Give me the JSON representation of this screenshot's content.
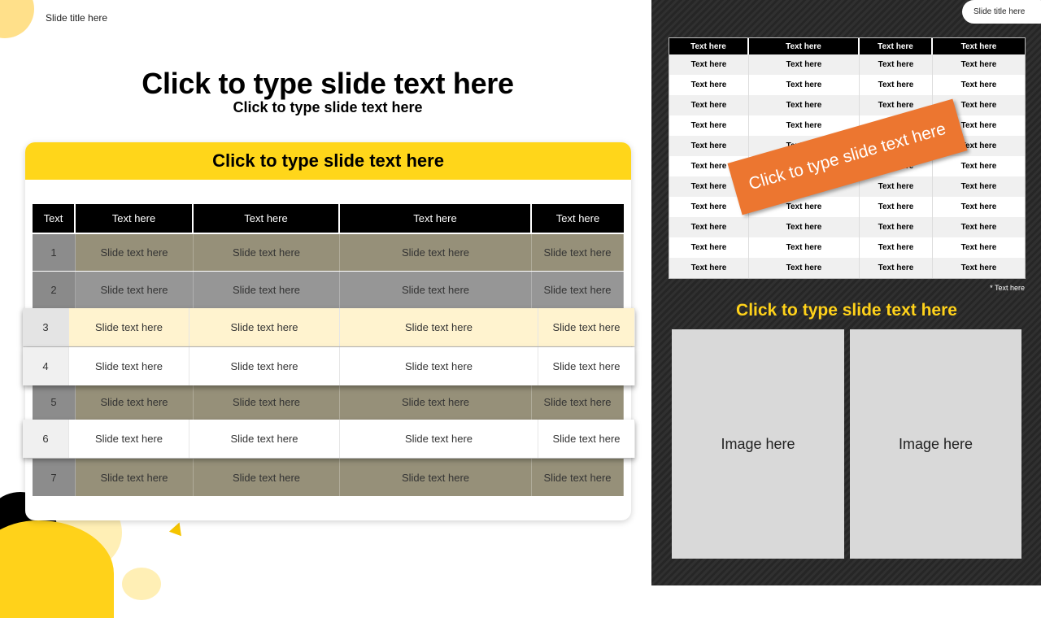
{
  "slide_title": "Slide title here",
  "main_title": "Click to type slide text here",
  "main_subtitle": "Click to type slide text here",
  "card_title": "Click to type slide text here",
  "table": {
    "headers": [
      "Text",
      "Text here",
      "Text here",
      "Text here",
      "Text here"
    ],
    "rows": [
      [
        "1",
        "Slide text here",
        "Slide text here",
        "Slide text here",
        "Slide text here"
      ],
      [
        "2",
        "Slide text here",
        "Slide text here",
        "Slide text here",
        "Slide text here"
      ],
      [
        "3",
        "Slide text here",
        "Slide text here",
        "Slide text here",
        "Slide text here"
      ],
      [
        "4",
        "Slide text here",
        "Slide text here",
        "Slide text here",
        "Slide text here"
      ],
      [
        "5",
        "Slide text here",
        "Slide text here",
        "Slide text here",
        "Slide text here"
      ],
      [
        "6",
        "Slide text here",
        "Slide text here",
        "Slide text here",
        "Slide text here"
      ],
      [
        "7",
        "Slide text here",
        "Slide text here",
        "Slide text here",
        "Slide text here"
      ]
    ]
  },
  "right_panel": {
    "pill_title": "Slide title here",
    "mini_table": {
      "headers": [
        "Text here",
        "Text here",
        "Text here",
        "Text here"
      ],
      "cell": "Text here",
      "row_count": 11
    },
    "note": "* Text here",
    "ribbon_text": "Click to type slide text here",
    "yellow_title": "Click to type slide text here",
    "image_placeholders": [
      "Image here",
      "Image here"
    ]
  },
  "colors": {
    "accent_yellow": "#ffd61a",
    "ribbon_orange": "#ec7630",
    "dark_panel": "#2b2b2b",
    "olive_row": "#969079"
  }
}
